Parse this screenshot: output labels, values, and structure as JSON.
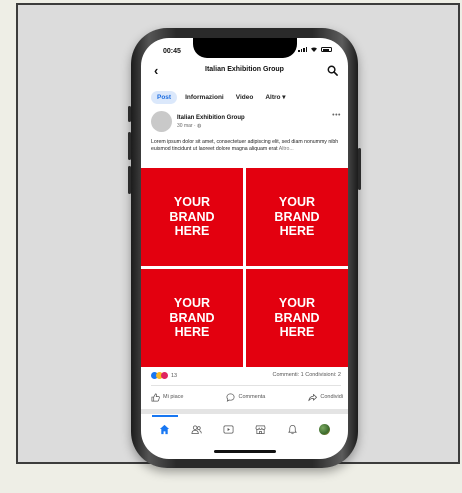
{
  "status": {
    "time": "00:45"
  },
  "header": {
    "title": "Italian Exhibition Group"
  },
  "tabs": [
    {
      "label": "Post"
    },
    {
      "label": "Informazioni"
    },
    {
      "label": "Video"
    },
    {
      "label": "Altro ▾"
    }
  ],
  "post": {
    "author": "Italian Exhibition Group",
    "meta": "30 mar · ◍",
    "text": "Lorem ipsum dolor sit amet, consectetuer adipiscing elit, sed diam nonummy nibh euismod tincidunt ut laoreet dolore magna aliquam erat",
    "more": "Altro...",
    "tiles": [
      "YOUR\nBRAND\nHERE",
      "YOUR\nBRAND\nHERE",
      "YOUR\nBRAND\nHERE",
      "YOUR\nBRAND\nHERE"
    ],
    "reactions_count": "13",
    "stats": "Commenti: 1  Condivisioni: 2",
    "actions": {
      "like": "Mi piace",
      "comment": "Commenta",
      "share": "Condividi"
    }
  },
  "colors": {
    "brand_red": "#e3000f",
    "accent_blue": "#1877f2"
  },
  "icons": [
    "back-icon",
    "search-icon",
    "more-icon",
    "like-icon",
    "comment-icon",
    "share-icon",
    "home-icon",
    "friends-icon",
    "watch-icon",
    "marketplace-icon",
    "notifications-icon",
    "menu-globe-icon"
  ]
}
